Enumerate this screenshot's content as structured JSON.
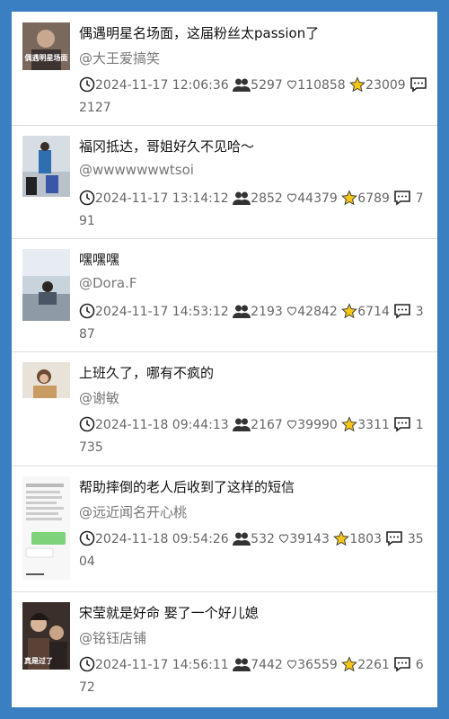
{
  "posts": [
    {
      "title": "偶遇明星名场面，这届粉丝太passion了",
      "author": "@大王爱搞笑",
      "time": "2024-11-17 12:06:36",
      "viewers": "5297",
      "likes": "110858",
      "favorites": "23009",
      "comments": "2127",
      "thumb_text": "偶遇明星场面"
    },
    {
      "title": "福冈抵达，哥姐好久不见哈～",
      "author": "@wwwwwwwtsoi",
      "time": "2024-11-17 13:14:12",
      "viewers": "2852",
      "likes": "44379",
      "favorites": "6789",
      "comments": "791"
    },
    {
      "title": "嘿嘿嘿",
      "author": "@Dora.F",
      "time": "2024-11-17 14:53:12",
      "viewers": "2193",
      "likes": "42842",
      "favorites": "6714",
      "comments": "387"
    },
    {
      "title": "上班久了，哪有不疯的",
      "author": "@谢敏",
      "time": "2024-11-18 09:44:13",
      "viewers": "2167",
      "likes": "39990",
      "favorites": "3311",
      "comments": "1735"
    },
    {
      "title": "帮助摔倒的老人后收到了这样的短信",
      "author": "@远近闻名开心桃",
      "time": "2024-11-18 09:54:26",
      "viewers": "532",
      "likes": "39143",
      "favorites": "1803",
      "comments": "3504"
    },
    {
      "title": "宋莹就是好命 娶了一个好儿媳",
      "author": "@铭钰店铺",
      "time": "2024-11-17 14:56:11",
      "viewers": "7442",
      "likes": "36559",
      "favorites": "2261",
      "comments": "672",
      "thumb_text": "真是过了"
    }
  ],
  "colors": {
    "background": "#3a7fc1",
    "star": "#f5c518"
  },
  "icons": {
    "time": "clock-icon",
    "viewers": "people-icon",
    "likes": "heart-icon",
    "favorites": "star-icon",
    "comments": "comment-icon"
  }
}
